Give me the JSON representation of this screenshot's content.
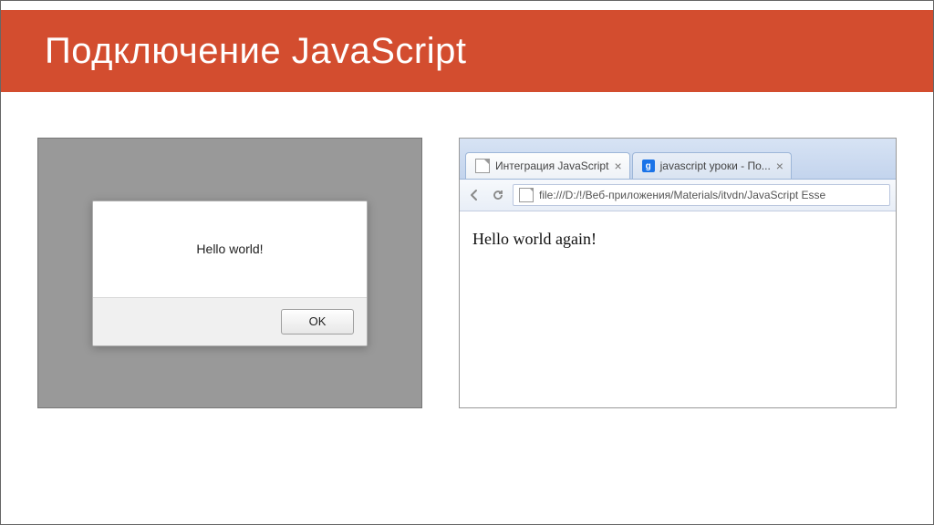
{
  "header": {
    "title": "Подключение JavaScript"
  },
  "alert": {
    "message": "Hello world!",
    "ok_label": "OK"
  },
  "browser": {
    "tabs": [
      {
        "label": "Интеграция JavaScript",
        "favicon": "document-icon"
      },
      {
        "label": "javascript уроки - По...",
        "favicon": "google-icon"
      }
    ],
    "address": "file:///D:/!/Веб-приложения/Materials/itvdn/JavaScript Esse",
    "page_text": "Hello world again!",
    "g_letter": "g"
  }
}
